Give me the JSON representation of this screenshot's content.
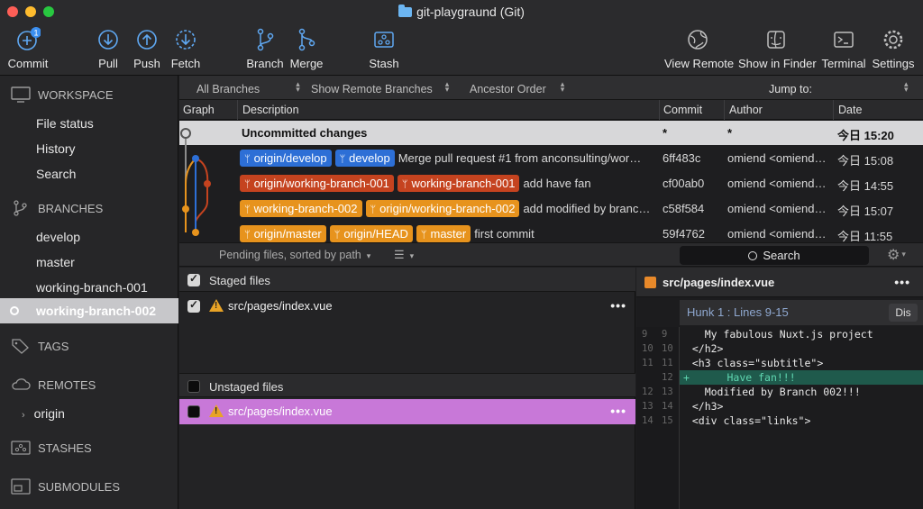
{
  "window": {
    "title": "git-playgraund (Git)"
  },
  "toolbar": {
    "commit": {
      "label": "Commit",
      "badge": "1"
    },
    "pull": "Pull",
    "push": "Push",
    "fetch": "Fetch",
    "branch": "Branch",
    "merge": "Merge",
    "stash": "Stash",
    "view_remote": "View Remote",
    "show_in_finder": "Show in Finder",
    "terminal": "Terminal",
    "settings": "Settings"
  },
  "sidebar": {
    "workspace": {
      "title": "WORKSPACE",
      "items": [
        "File status",
        "History",
        "Search"
      ]
    },
    "branches": {
      "title": "BRANCHES",
      "items": [
        "develop",
        "master",
        "working-branch-001"
      ],
      "selected": "working-branch-002"
    },
    "tags": "TAGS",
    "remotes": {
      "title": "REMOTES",
      "items": [
        "origin"
      ]
    },
    "stashes": "STASHES",
    "submodules": "SUBMODULES"
  },
  "filters": {
    "branches": "All Branches",
    "remote": "Show Remote Branches",
    "order": "Ancestor Order",
    "jump_to": "Jump to:"
  },
  "columns": {
    "graph": "Graph",
    "description": "Description",
    "commit": "Commit",
    "author": "Author",
    "date": "Date"
  },
  "commits": [
    {
      "description": "Uncommitted changes",
      "commit": "*",
      "author": "*",
      "date": "今日 15:20",
      "tags": []
    },
    {
      "description": "Merge pull request #1 from anconsulting/wor…",
      "commit": "6ff483c",
      "author": "omiend <omiend…",
      "date": "今日 15:08",
      "tags": [
        {
          "label": "origin/develop",
          "color": "#2d6fd6"
        },
        {
          "label": "develop",
          "color": "#2d6fd6"
        }
      ]
    },
    {
      "description": "add have fan",
      "commit": "cf00ab0",
      "author": "omiend <omiend…",
      "date": "今日 14:55",
      "tags": [
        {
          "label": "origin/working-branch-001",
          "color": "#c5431f"
        },
        {
          "label": "working-branch-001",
          "color": "#c5431f"
        }
      ]
    },
    {
      "description": "add modified by branc…",
      "commit": "c58f584",
      "author": "omiend <omiend…",
      "date": "今日 15:07",
      "tags": [
        {
          "label": "working-branch-002",
          "color": "#e7931d"
        },
        {
          "label": "origin/working-branch-002",
          "color": "#e7931d"
        }
      ]
    },
    {
      "description": "first commit",
      "commit": "59f4762",
      "author": "omiend <omiend…",
      "date": "今日 11:55",
      "tags": [
        {
          "label": "origin/master",
          "color": "#e7931d"
        },
        {
          "label": "origin/HEAD",
          "color": "#e7931d"
        },
        {
          "label": "master",
          "color": "#e7931d"
        }
      ]
    }
  ],
  "pending": {
    "label": "Pending files, sorted by path",
    "search": "Search"
  },
  "staged": {
    "title": "Staged files",
    "files": [
      "src/pages/index.vue"
    ]
  },
  "unstaged": {
    "title": "Unstaged files",
    "files": [
      "src/pages/index.vue"
    ]
  },
  "diff": {
    "file": "src/pages/index.vue",
    "hunk": "Hunk 1 : Lines 9-15",
    "discard": "Dis",
    "lines": [
      {
        "old": "9",
        "new": "9",
        "text": "    My fabulous Nuxt.js project",
        "type": "ctx"
      },
      {
        "old": "10",
        "new": "10",
        "text": "  </h2>",
        "type": "ctx"
      },
      {
        "old": "11",
        "new": "11",
        "text": "  <h3 class=\"subtitle\">",
        "type": "ctx"
      },
      {
        "old": "",
        "new": "12",
        "text": "    Have fan!!!",
        "type": "add"
      },
      {
        "old": "12",
        "new": "13",
        "text": "    Modified by Branch 002!!!",
        "type": "ctx"
      },
      {
        "old": "13",
        "new": "14",
        "text": "  </h3>",
        "type": "ctx"
      },
      {
        "old": "14",
        "new": "15",
        "text": "  <div class=\"links\">",
        "type": "ctx"
      }
    ]
  },
  "colors": {
    "blue": "#2d6fd6",
    "red": "#c5431f",
    "orange": "#e7931d",
    "add_line": "#1f5a4c",
    "selection": "#c878d8"
  }
}
